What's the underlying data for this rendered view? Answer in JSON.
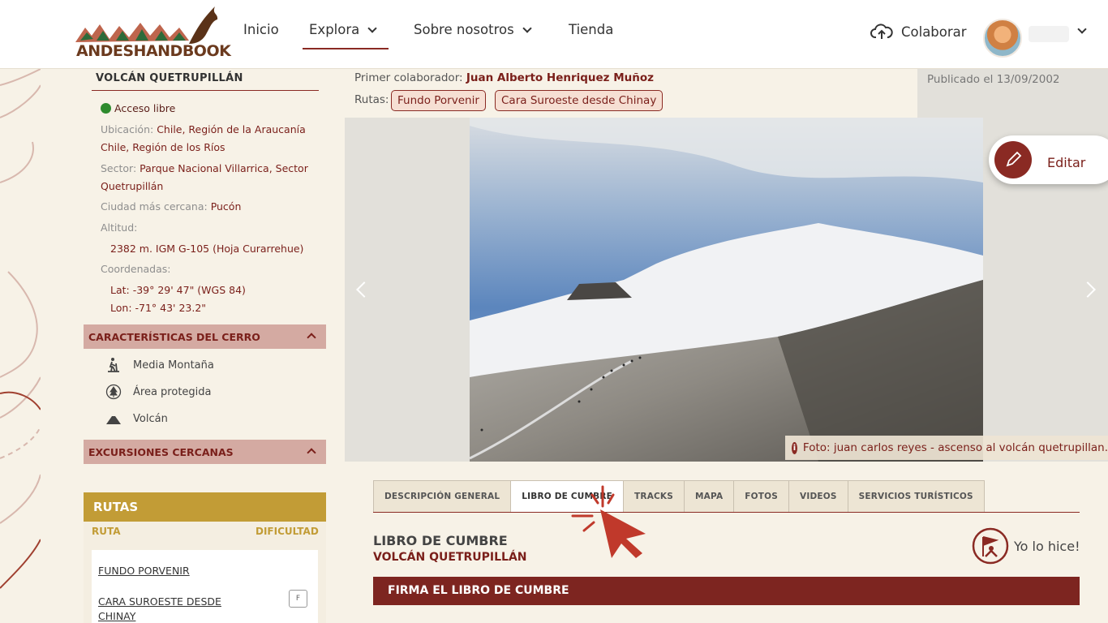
{
  "header": {
    "logo_text": "ANDESHANDBOOK",
    "nav": [
      {
        "label": "Inicio"
      },
      {
        "label": "Explora"
      },
      {
        "label": "Sobre nosotros"
      },
      {
        "label": "Tienda"
      }
    ],
    "colaborar_label": "Colaborar"
  },
  "sidebar": {
    "title": "VOLCÁN QUETRUPILLÁN",
    "acceso": "Acceso libre",
    "ubicacion_label": "Ubicación:",
    "ubicacion_1": "Chile, Región de la Araucanía",
    "ubicacion_2": "Chile, Región de los Ríos",
    "sector_label": "Sector:",
    "sector_1": "Parque Nacional Villarrica, Sector",
    "sector_2": "Quetrupillán",
    "ciudad_label": "Ciudad más cercana:",
    "ciudad": "Pucón",
    "altitud_label": "Altitud:",
    "altitud": "2382 m. IGM G-105 (Hoja Curarrehue)",
    "coordenadas_label": "Coordenadas:",
    "lat": "Lat: -39° 29' 47\" (WGS 84)",
    "lon": "Lon: -71° 43' 23.2\"",
    "caracteristicas_title": "CARACTERÍSTICAS DEL CERRO",
    "features": [
      {
        "label": "Media Montaña",
        "icon": "hiker-icon"
      },
      {
        "label": "Área protegida",
        "icon": "tree-icon"
      },
      {
        "label": "Volcán",
        "icon": "volcano-icon"
      }
    ],
    "excursiones_title": "EXCURSIONES CERCANAS",
    "rutas": {
      "title": "RUTAS",
      "col_ruta": "RUTA",
      "col_dificultad": "DIFICULTAD",
      "items": [
        {
          "name": "FUNDO PORVENIR",
          "dificultad": ""
        },
        {
          "name_1": "CARA SUROESTE DESDE",
          "name_2": "CHINAY",
          "dificultad": "F"
        }
      ]
    }
  },
  "main": {
    "colaborador_label": "Primer colaborador:",
    "colaborador": "Juan Alberto Henriquez Muñoz",
    "rutas_label": "Rutas:",
    "route_chips": [
      "Fundo Porvenir",
      "Cara Suroeste desde Chinay"
    ],
    "publicado": "Publicado el 13/09/2002",
    "caption": "Foto: juan carlos reyes - ascenso al volcán quetrupillan.",
    "edit_label": "Editar",
    "tabs": [
      {
        "label": "DESCRIPCIÓN GENERAL",
        "active": false
      },
      {
        "label": "LIBRO DE CUMBRE",
        "active": true
      },
      {
        "label": "TRACKS",
        "active": false
      },
      {
        "label": "MAPA",
        "active": false
      },
      {
        "label": "FOTOS",
        "active": false
      },
      {
        "label": "VIDEOS",
        "active": false
      },
      {
        "label": "SERVICIOS TURÍSTICOS",
        "active": false
      }
    ],
    "section_title": "LIBRO DE CUMBRE",
    "section_subtitle": "VOLCÁN QUETRUPILLÁN",
    "yolohice_label": "Yo lo hice!",
    "firma_label": "FIRMA EL LIBRO DE CUMBRE"
  },
  "colors": {
    "brand_red": "#8a2a23",
    "gold": "#c29c36",
    "accordion_bg": "#d4aaa2",
    "page_bg": "#f7f2e7"
  }
}
